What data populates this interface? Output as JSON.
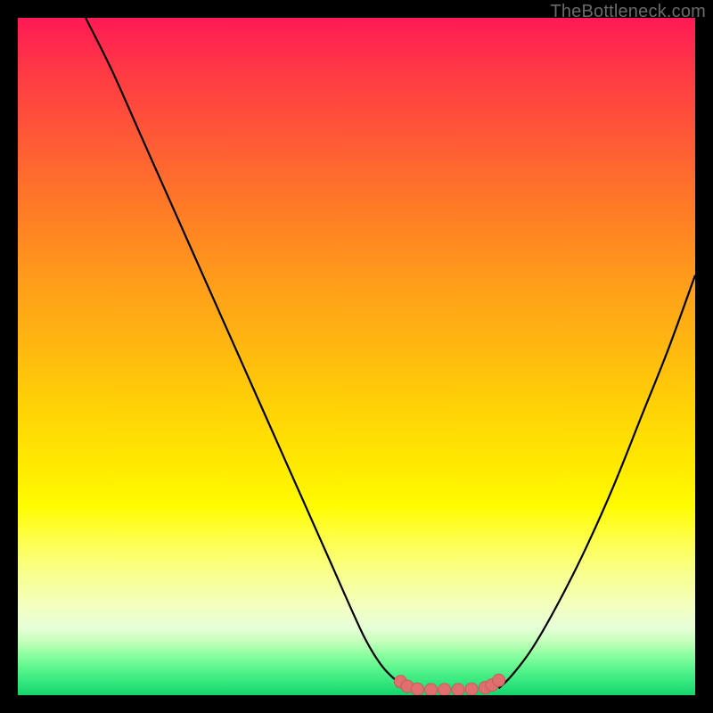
{
  "watermark": "TheBottleneck.com",
  "colors": {
    "page_bg": "#000000",
    "curve": "#000000",
    "marker_fill": "#e07070",
    "marker_stroke": "#c95a5a",
    "gradient_top": "#ff1a55",
    "gradient_mid": "#ffe900",
    "gradient_bottom": "#15d46c"
  },
  "chart_data": {
    "type": "line",
    "title": "",
    "xlabel": "",
    "ylabel": "",
    "xlim": [
      0,
      100
    ],
    "ylim": [
      0,
      100
    ],
    "grid": false,
    "series": [
      {
        "name": "left-curve",
        "x": [
          10,
          14,
          18,
          22,
          26,
          30,
          34,
          38,
          42,
          46,
          50,
          52,
          54,
          56,
          57
        ],
        "y": [
          100,
          92,
          83,
          74,
          65,
          56,
          47,
          38,
          29,
          20,
          11,
          7,
          4,
          2,
          1
        ]
      },
      {
        "name": "right-curve",
        "x": [
          71,
          73,
          76,
          80,
          84,
          88,
          92,
          96,
          100
        ],
        "y": [
          1,
          3,
          7,
          14,
          22,
          31,
          41,
          51,
          62
        ]
      },
      {
        "name": "markers",
        "x": [
          56.5,
          57.5,
          59,
          61,
          63,
          65,
          67,
          69,
          70,
          71
        ],
        "y": [
          2.0,
          1.3,
          0.9,
          0.8,
          0.8,
          0.8,
          0.9,
          1.1,
          1.5,
          2.2
        ]
      }
    ]
  }
}
